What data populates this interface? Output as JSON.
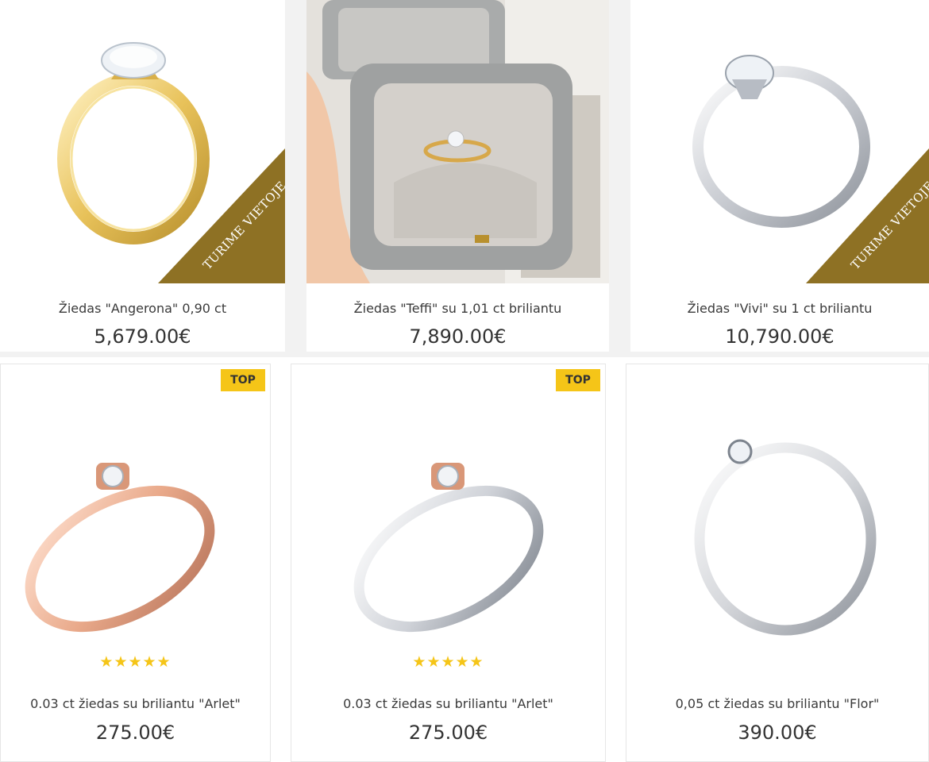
{
  "products": [
    {
      "title": "Žiedas \"Angerona\" 0,90 ct",
      "price": "5,679.00€",
      "badge": "TURIME VIETOJE",
      "metal_color": "#e8c25a",
      "image": "gold-solitaire-ring"
    },
    {
      "title": "Žiedas \"Teffi\" su 1,01 ct briliantu",
      "price": "7,890.00€",
      "image": "ring-in-grey-box-photo"
    },
    {
      "title": "Žiedas \"Vivi\" su 1 ct briliantu",
      "price": "10,790.00€",
      "badge": "TURIME VIETOJE",
      "metal_color": "#d6d8dc",
      "image": "white-gold-solitaire-ring"
    },
    {
      "title": "0.03 ct žiedas su briliantu \"Arlet\"",
      "price": "275.00€",
      "top_label": "TOP",
      "rating": 5,
      "stars": "★★★★★",
      "metal_color": "#e9a98a",
      "image": "rose-gold-bezel-ring"
    },
    {
      "title": "0.03 ct žiedas su briliantu \"Arlet\"",
      "price": "275.00€",
      "top_label": "TOP",
      "rating": 5,
      "stars": "★★★★★",
      "metal_color": "#cfd2d8",
      "image": "white-gold-bezel-ring"
    },
    {
      "title": "0,05 ct žiedas su briliantu \"Flor\"",
      "price": "390.00€",
      "metal_color": "#d6d8dc",
      "image": "white-gold-small-diamond-ring"
    }
  ],
  "colors": {
    "badge_brown": "#8e7124",
    "top_yellow": "#f5c518",
    "star_yellow": "#f5c518"
  }
}
